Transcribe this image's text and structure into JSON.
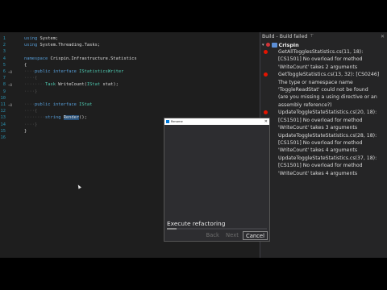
{
  "editor": {
    "lines": [
      {
        "num": "1",
        "marker": "",
        "code": [
          {
            "t": "using ",
            "c": "kw"
          },
          {
            "t": "System;",
            "c": ""
          }
        ]
      },
      {
        "num": "2",
        "marker": "",
        "code": [
          {
            "t": "using ",
            "c": "kw"
          },
          {
            "t": "System.Threading.Tasks;",
            "c": ""
          }
        ]
      },
      {
        "num": "3",
        "marker": "",
        "code": []
      },
      {
        "num": "4",
        "marker": "",
        "code": [
          {
            "t": "namespace ",
            "c": "kw"
          },
          {
            "t": "Crispin.Infrastructure.Statistics",
            "c": ""
          }
        ]
      },
      {
        "num": "5",
        "marker": "",
        "code": [
          {
            "t": "{",
            "c": ""
          }
        ]
      },
      {
        "num": "6",
        "marker": "⌁0",
        "code": [
          {
            "t": "····",
            "c": "guide"
          },
          {
            "t": "public interface ",
            "c": "kw"
          },
          {
            "t": "IStatisticsWriter",
            "c": "ty"
          }
        ]
      },
      {
        "num": "7",
        "marker": "",
        "code": [
          {
            "t": "····{",
            "c": "guide"
          }
        ]
      },
      {
        "num": "8",
        "marker": "⌁0",
        "code": [
          {
            "t": "········",
            "c": "guide"
          },
          {
            "t": "Task",
            "c": "ty"
          },
          {
            "t": " WriteCount(",
            "c": ""
          },
          {
            "t": "IStat",
            "c": "ty"
          },
          {
            "t": " stat);",
            "c": ""
          }
        ]
      },
      {
        "num": "9",
        "marker": "",
        "code": [
          {
            "t": "····}",
            "c": "guide"
          }
        ]
      },
      {
        "num": "10",
        "marker": "",
        "code": []
      },
      {
        "num": "11",
        "marker": "⌁0",
        "code": [
          {
            "t": "····",
            "c": "guide"
          },
          {
            "t": "public interface ",
            "c": "kw"
          },
          {
            "t": "IStat",
            "c": "ty"
          }
        ]
      },
      {
        "num": "12",
        "marker": "",
        "code": [
          {
            "t": "····{",
            "c": "guide"
          }
        ]
      },
      {
        "num": "13",
        "marker": "",
        "code": [
          {
            "t": "········",
            "c": "guide"
          },
          {
            "t": "string ",
            "c": "kw"
          },
          {
            "t": "Render",
            "c": "sel"
          },
          {
            "t": "();",
            "c": ""
          }
        ]
      },
      {
        "num": "14",
        "marker": "",
        "code": [
          {
            "t": "····}",
            "c": "guide"
          }
        ]
      },
      {
        "num": "15",
        "marker": "",
        "code": [
          {
            "t": "}",
            "c": ""
          }
        ]
      },
      {
        "num": "16",
        "marker": "",
        "code": []
      }
    ]
  },
  "build_panel": {
    "title": "Build - Build failed",
    "pin_icon": "pin-icon",
    "close_icon": "close-icon",
    "project": "Crispin",
    "errors": [
      {
        "text": "GetAllTogglesStatistics.cs(11, 18):\n[CS1501] No overload for method\n'WriteCount' takes 2 arguments"
      },
      {
        "text": "GetToggleStatistics.cs(13, 32): [CS0246]\nThe type or namespace name\n'ToggleReadStat' could not be found\n(are you missing a using directive or an\nassembly reference?)"
      },
      {
        "text": "UpdateToggleStateStatistics.cs(20, 18):\n[CS1501] No overload for method\n'WriteCount' takes 3 arguments"
      },
      {
        "text": "UpdateToggleStateStatistics.cs(28, 18):\n[CS1501] No overload for method\n'WriteCount' takes 4 arguments"
      },
      {
        "text": "UpdateToggleStateStatistics.cs(37, 18):\n[CS1501] No overload for method\n'WriteCount' takes 4 arguments"
      }
    ]
  },
  "dialog": {
    "title": "Rename",
    "status": "Execute refactoring",
    "progress": 0.1,
    "buttons": {
      "back": "Back",
      "next": "Next",
      "cancel": "Cancel"
    }
  }
}
